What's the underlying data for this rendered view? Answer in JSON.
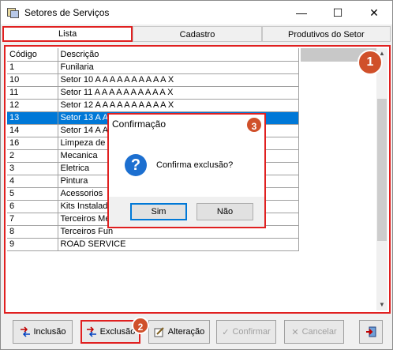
{
  "window": {
    "title": "Setores de Serviços",
    "minimize": "—",
    "maximize": "☐",
    "close": "✕"
  },
  "tabs": [
    {
      "label": "Lista"
    },
    {
      "label": "Cadastro"
    },
    {
      "label": "Produtivos do Setor"
    }
  ],
  "grid": {
    "columns": [
      "Código",
      "Descrição"
    ],
    "rows": [
      [
        "1",
        "Funilaria"
      ],
      [
        "10",
        "Setor 10 A A A A A A A A A A X"
      ],
      [
        "11",
        "Setor 11 A A A A A A A A A A X"
      ],
      [
        "12",
        "Setor 12 A A A A A A A A A A X"
      ],
      [
        "13",
        "Setor 13 A A A"
      ],
      [
        "14",
        "Setor 14 A A"
      ],
      [
        "16",
        "Limpeza de B"
      ],
      [
        "2",
        "Mecanica"
      ],
      [
        "3",
        "Eletrica"
      ],
      [
        "4",
        "Pintura"
      ],
      [
        "5",
        "Acessorios"
      ],
      [
        "6",
        "Kits Instalado"
      ],
      [
        "7",
        "Terceiros Me"
      ],
      [
        "8",
        "Terceiros Fun"
      ],
      [
        "9",
        "ROAD SERVICE"
      ]
    ],
    "selected_index": 4
  },
  "badges": {
    "one": "1",
    "two": "2",
    "three": "3"
  },
  "toolbar": {
    "inclusao": "Inclusão",
    "exclusao": "Exclusão",
    "alteracao": "Alteração",
    "confirmar": "Confirmar",
    "cancelar": "Cancelar"
  },
  "dialog": {
    "title": "Confirmação",
    "message": "Confirma exclusão?",
    "yes": "Sim",
    "no": "Não"
  },
  "colors": {
    "highlight": "#e02020",
    "selection": "#0078d7",
    "badge": "#d0502a"
  }
}
